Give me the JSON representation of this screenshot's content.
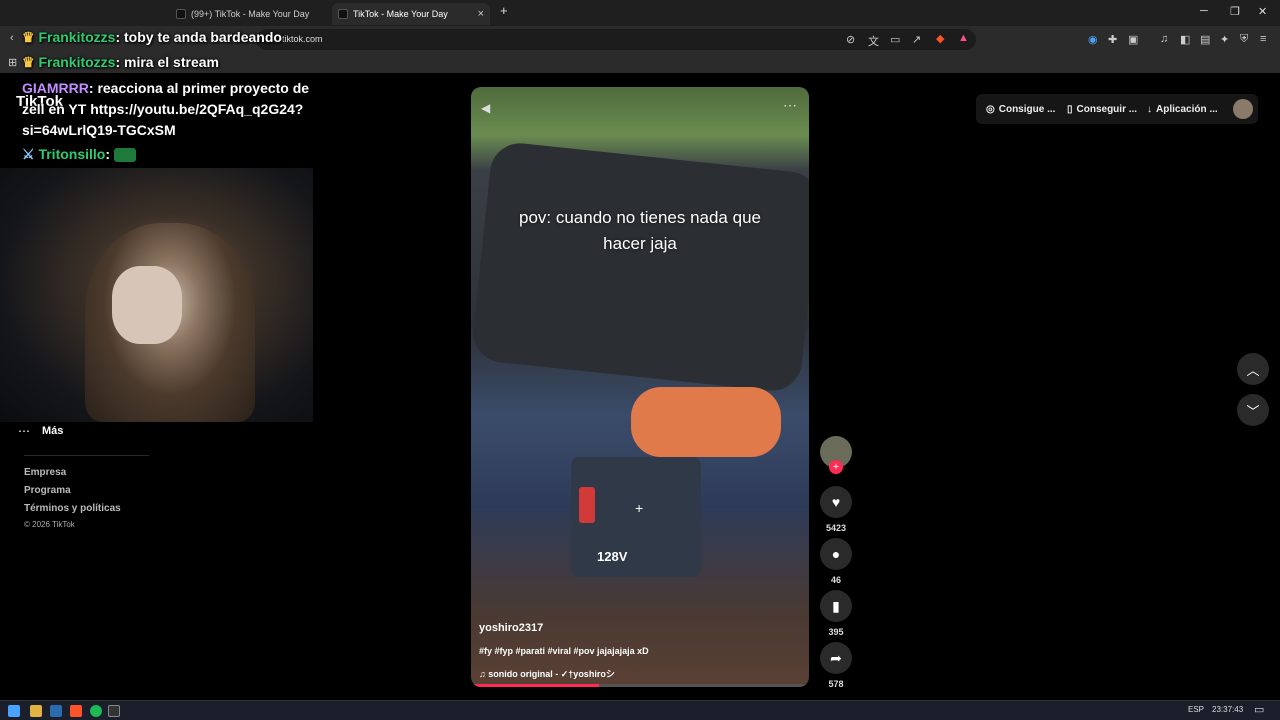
{
  "browser": {
    "tabs": [
      {
        "label": "(99+) TikTok - Make Your Day"
      },
      {
        "label": "TikTok - Make Your Day"
      }
    ],
    "url": "tiktok.com",
    "new_tab": "+",
    "win_min": "─",
    "win_max": "❐",
    "win_close": "✕"
  },
  "chat": {
    "lines": [
      {
        "user": "Frankitozzs",
        "text": ": toby te anda bardeando"
      },
      {
        "user": "Frankitozzs",
        "text": ": mira el stream"
      },
      {
        "user": "GIAMRRR",
        "text": ": reacciona al primer proyecto de zell en YT https://youtu.be/2QFAq_q2G24?si=64wLrlQ19-TGCxSM"
      },
      {
        "user": "Tritonsillo",
        "text": ":"
      }
    ]
  },
  "tiktok": {
    "logo": "TikTok",
    "sidebar": {
      "more": "Más",
      "links": [
        "Empresa",
        "Programa",
        "Términos y políticas"
      ],
      "copyright": "© 2026 TikTok"
    },
    "header_buttons": [
      {
        "label": "Consigue ...",
        "icon": "coin-icon"
      },
      {
        "label": "Conseguir ...",
        "icon": "phone-icon"
      },
      {
        "label": "Aplicación ...",
        "icon": "download-icon"
      }
    ],
    "video": {
      "caption": "pov: cuando no tienes nada que hacer jaja",
      "author": "yoshiro2317",
      "hashtags": "#fy #fyp #parati #viral #pov jajajajaja xD",
      "sound": "sonido original - ✓†yoshiroシ",
      "battery_label": "128V"
    },
    "actions": {
      "likes": "5423",
      "comments": "46",
      "saves": "395",
      "shares": "578"
    }
  },
  "taskbar": {
    "lang": "ESP",
    "time": "23:37:43"
  },
  "colors": {
    "tiktok_red": "#fe2c55",
    "chat_user": "#2ecc71",
    "chat_user2": "#c38cff"
  }
}
